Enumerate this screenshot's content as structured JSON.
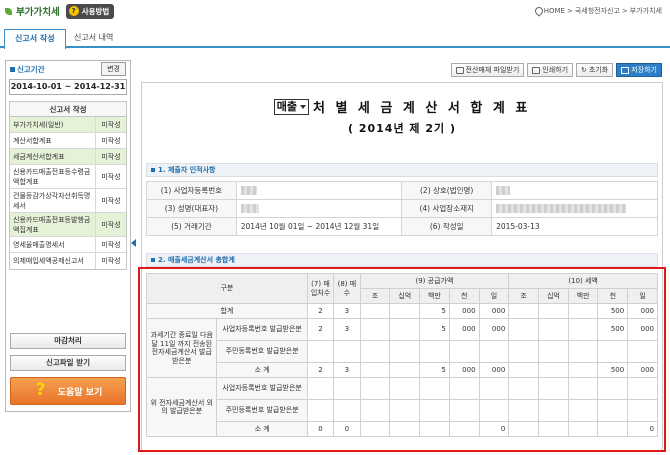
{
  "header": {
    "app_title": "부가가치세",
    "howto_label": "사용방법",
    "breadcrumb": [
      "HOME",
      ">",
      "국세청전자신고",
      ">",
      "부가가치세"
    ]
  },
  "tabs": [
    {
      "label": "신고서 작성",
      "active": true
    },
    {
      "label": "신고서 내역",
      "active": false
    }
  ],
  "sidebar": {
    "period_label": "신고기간",
    "change_label": "변경",
    "period_value": "2014-10-01 ~ 2014-12-31",
    "forms_title": "신고서 작성",
    "forms": [
      {
        "name": "부가가치세(일반)",
        "status": "미작성",
        "highlight": true
      },
      {
        "name": "계산서합계표",
        "status": "미작성",
        "highlight": false
      },
      {
        "name": "세금계산서합계표",
        "status": "미작성",
        "highlight": true
      },
      {
        "name": "신용카드매출전표등수령금액합계표",
        "status": "미작성",
        "highlight": false
      },
      {
        "name": "건물등감가상각자산취득명세서",
        "status": "미작성",
        "highlight": false
      },
      {
        "name": "신용카드매출전표등발행금액집계표",
        "status": "미작성",
        "highlight": true
      },
      {
        "name": "영세율매출명세서",
        "status": "미작성",
        "highlight": false
      },
      {
        "name": "의제매입세액공제신고서",
        "status": "미작성",
        "highlight": false
      }
    ],
    "finish_label": "마감처리",
    "receive_label": "신고파일 받기",
    "help_label": "도움말 보기"
  },
  "toolbar": {
    "download_label": "전산매체 파일받기",
    "print_label": "인쇄하기",
    "reset_label": "초기화",
    "save_label": "저장하기"
  },
  "document": {
    "select_value": "매출",
    "title": "처 별 세 금 계 산 서 합 계 표",
    "subtitle": "( 2014년 제 2기 )",
    "section1_title": "1. 제출자 인적사항",
    "section2_title": "2. 매출세금계산서 총합계",
    "info": {
      "biz_no_label": "(1) 사업자등록번호",
      "trade_name_label": "(2) 상호(법인명)",
      "rep_name_label": "(3) 성명(대표자)",
      "address_label": "(4) 사업장소재지",
      "period_label": "(5) 거래기간",
      "period_value": "2014년 10월 01일 ~ 2014년 12월 31일",
      "date_label": "(6) 작성일",
      "date_value": "2015-03-13"
    }
  },
  "summary": {
    "col_category": "구분",
    "col_buyers": "(7) 매입처수",
    "col_sheets": "(8) 매수",
    "col_supply": "(9) 공급가액",
    "col_tax": "(10) 세액",
    "units": [
      "조",
      "십억",
      "백만",
      "천",
      "일"
    ],
    "total_label": "합계",
    "group1_label": "과세기간 종료일 다음달 11일 까지 전송된 전자세금계산서 발급받은분",
    "group2_label": "위 전자세금계산서 외 의 발급받은분",
    "biz_reg_label": "사업자등록번호 발급받은분",
    "resident_reg_label": "주민등록번호 발급받은분",
    "subtotal_label": "소 계",
    "rows": {
      "total": {
        "buyers": "2",
        "sheets": "3",
        "supply": [
          "",
          "",
          "5",
          "000",
          "000"
        ],
        "tax": [
          "",
          "",
          "",
          "500",
          "000"
        ]
      },
      "g1_biz": {
        "buyers": "2",
        "sheets": "3",
        "supply": [
          "",
          "",
          "5",
          "000",
          "000"
        ],
        "tax": [
          "",
          "",
          "",
          "500",
          "000"
        ]
      },
      "g1_res": {
        "buyers": "",
        "sheets": "",
        "supply": [
          "",
          "",
          "",
          "",
          ""
        ],
        "tax": [
          "",
          "",
          "",
          "",
          ""
        ]
      },
      "g1_sub": {
        "buyers": "2",
        "sheets": "3",
        "supply": [
          "",
          "",
          "5",
          "000",
          "000"
        ],
        "tax": [
          "",
          "",
          "",
          "500",
          "000"
        ]
      },
      "g2_biz": {
        "buyers": "",
        "sheets": "",
        "supply": [
          "",
          "",
          "",
          "",
          ""
        ],
        "tax": [
          "",
          "",
          "",
          "",
          ""
        ]
      },
      "g2_res": {
        "buyers": "",
        "sheets": "",
        "supply": [
          "",
          "",
          "",
          "",
          ""
        ],
        "tax": [
          "",
          "",
          "",
          "",
          ""
        ]
      },
      "g2_sub": {
        "buyers": "0",
        "sheets": "0",
        "supply": [
          "",
          "",
          "",
          "",
          "0"
        ],
        "tax": [
          "",
          "",
          "",
          "",
          "0"
        ]
      }
    }
  }
}
